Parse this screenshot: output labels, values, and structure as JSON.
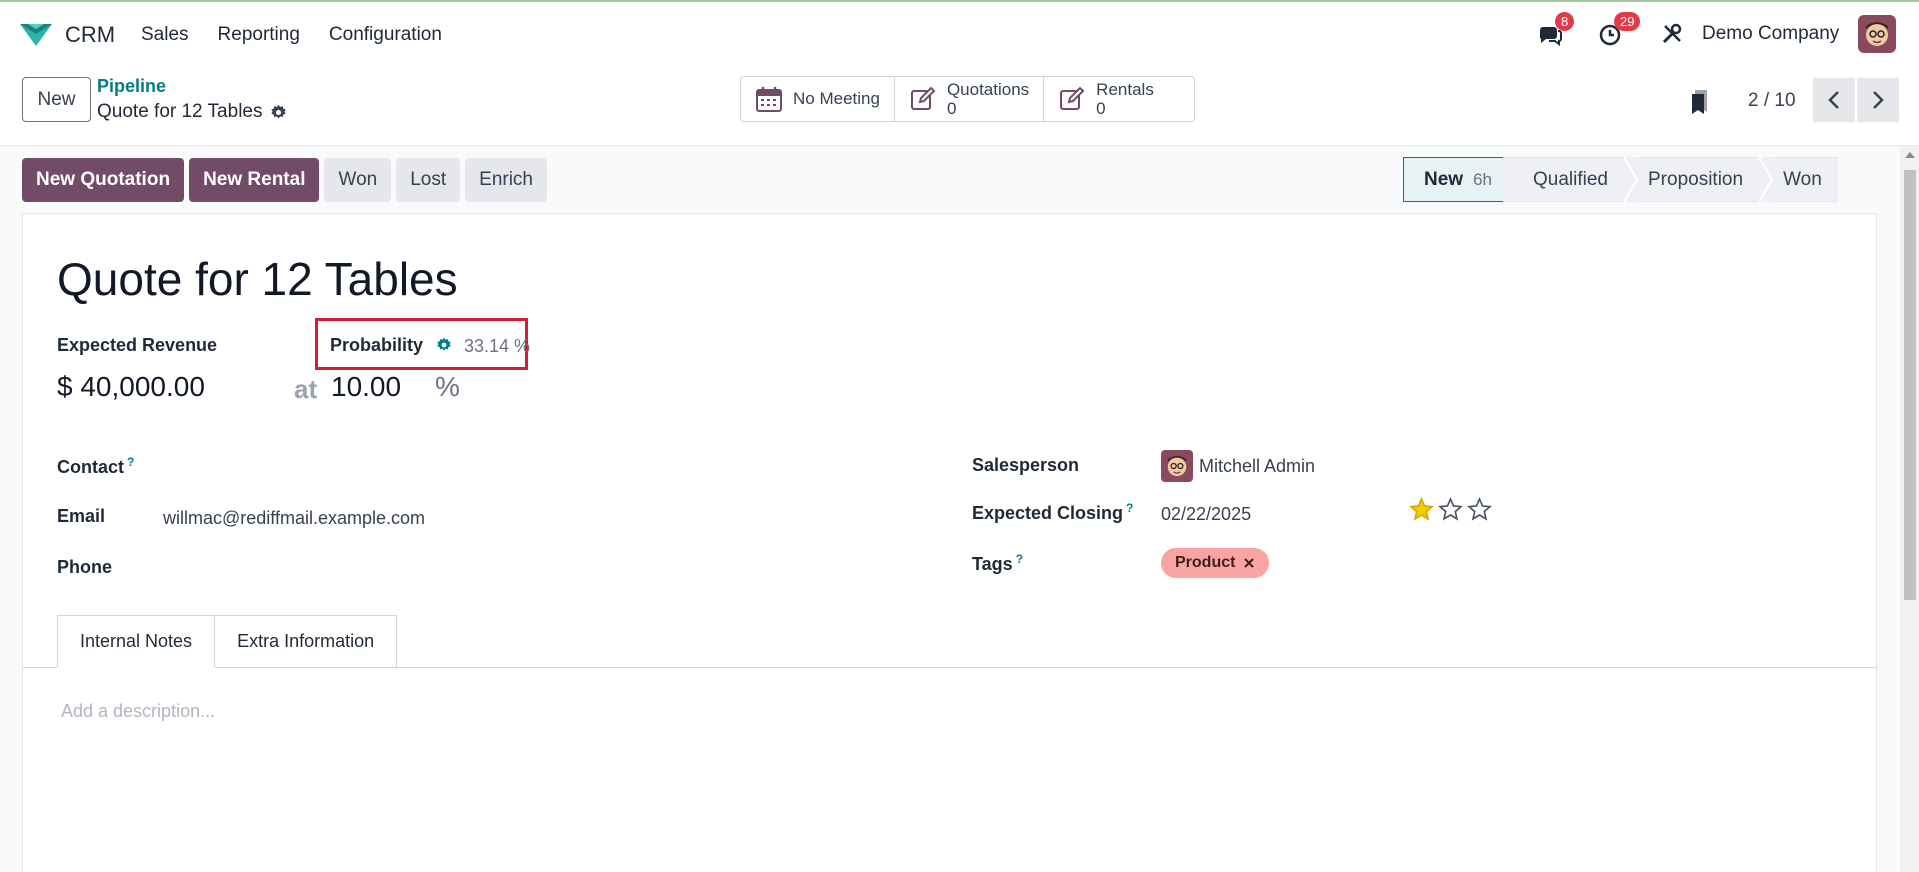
{
  "nav": {
    "app_name": "CRM",
    "menu": [
      "Sales",
      "Reporting",
      "Configuration"
    ],
    "messages_count": "8",
    "activities_count": "29",
    "company": "Demo Company"
  },
  "control": {
    "new_label": "New",
    "breadcrumb_parent": "Pipeline",
    "breadcrumb_current": "Quote for 12 Tables",
    "smart_buttons": {
      "meeting": "No Meeting",
      "quotations_label": "Quotations",
      "quotations_count": "0",
      "rentals_label": "Rentals",
      "rentals_count": "0"
    },
    "pager": "2 / 10"
  },
  "actions": {
    "new_quotation": "New Quotation",
    "new_rental": "New Rental",
    "won": "Won",
    "lost": "Lost",
    "enrich": "Enrich"
  },
  "stages": {
    "new": "New",
    "new_duration": "6h",
    "qualified": "Qualified",
    "proposition": "Proposition",
    "won": "Won"
  },
  "form": {
    "title": "Quote for 12 Tables",
    "expected_revenue_label": "Expected Revenue",
    "probability_label": "Probability",
    "probability_auto": "33.14 %",
    "revenue": "$ 40,000.00",
    "at": "at",
    "probability_value": "10.00",
    "percent": "%",
    "contact_label": "Contact",
    "email_label": "Email",
    "email_value": "willmac@rediffmail.example.com",
    "phone_label": "Phone",
    "salesperson_label": "Salesperson",
    "salesperson_value": "Mitchell Admin",
    "expected_closing_label": "Expected Closing",
    "expected_closing_value": "02/22/2025",
    "priority_stars": 1,
    "tags_label": "Tags",
    "tag": "Product",
    "help_mark": "?"
  },
  "tabs": {
    "internal_notes": "Internal Notes",
    "extra_information": "Extra Information"
  },
  "notes": {
    "placeholder": "Add a description..."
  },
  "colors": {
    "primary": "#714b67",
    "link": "#017e84",
    "highlight": "#d0202d",
    "tag": "#f9a3a3",
    "star": "#f3cc00"
  }
}
